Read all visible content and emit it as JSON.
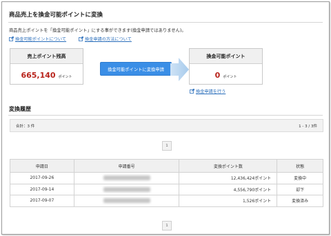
{
  "page": {
    "title": "商品売上を換金可能ポイントに変換",
    "description": "商品売上ポイントを「換金可能ポイント」にする事ができます(換金申請ではありません)。"
  },
  "links": {
    "about_points": "換金可能ポイントについて",
    "how_to_apply": "換金申請の方法について",
    "do_apply": "換金申請を行う"
  },
  "sales_box": {
    "label": "売上ポイント残高",
    "value": "665,140",
    "unit": "ポイント"
  },
  "convertible_box": {
    "label": "換金可能ポイント",
    "value": "0",
    "unit": "ポイント"
  },
  "convert_button": "換金可能ポイントに変換申請",
  "history": {
    "title": "変換履歴",
    "total": "合計：3 件",
    "range": "1 - 3 / 3件",
    "page": "1",
    "columns": [
      "申請日",
      "申請番号",
      "変換ポイント数",
      "状態"
    ],
    "rows": [
      {
        "date": "2017-09-26",
        "points": "12,436,424ポイント",
        "status": "変換中"
      },
      {
        "date": "2017-09-14",
        "points": "4,556,790ポイント",
        "status": "却下"
      },
      {
        "date": "2017-09-07",
        "points": "1,526ポイント",
        "status": "変換済み"
      }
    ]
  },
  "colors": {
    "accent": "#3a8ee6",
    "value_red": "#b8231b",
    "link": "#2a6ebb"
  }
}
